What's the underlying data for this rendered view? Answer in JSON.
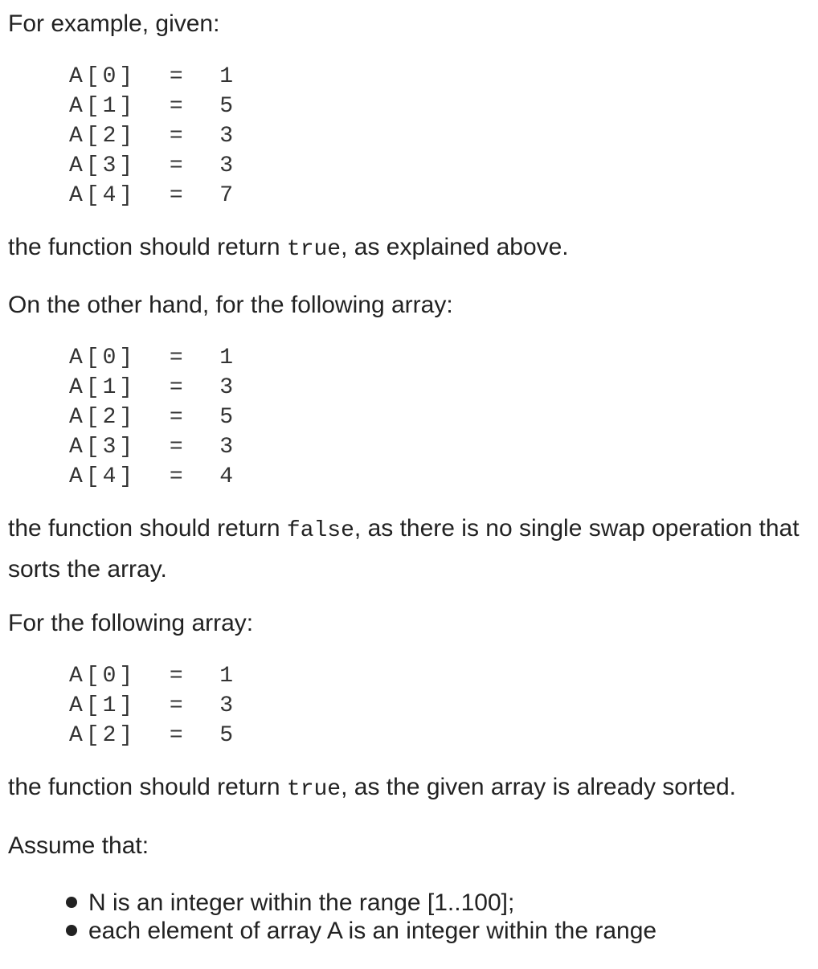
{
  "intro": "For example, given:",
  "example1": {
    "lines": [
      "A[0]  =  1",
      "A[1]  =  5",
      "A[2]  =  3",
      "A[3]  =  3",
      "A[4]  =  7"
    ],
    "result_pre": "the function should return ",
    "result_code": "true",
    "result_post": ", as explained above."
  },
  "example2": {
    "intro": "On the other hand, for the following array:",
    "lines": [
      "A[0]  =  1",
      "A[1]  =  3",
      "A[2]  =  5",
      "A[3]  =  3",
      "A[4]  =  4"
    ],
    "result_pre": "the function should return ",
    "result_code": "false",
    "result_post": ", as there is no single swap operation that sorts the array."
  },
  "example3": {
    "intro": "For the following array:",
    "lines": [
      "A[0]  =  1",
      "A[1]  =  3",
      "A[2]  =  5"
    ],
    "result_pre": "the function should return ",
    "result_code": "true",
    "result_post": ", as the given array is already sorted."
  },
  "assume": {
    "heading": "Assume that:",
    "items": [
      "N is an integer within the range [1..100];",
      "each element of array A is an integer within the range"
    ]
  }
}
